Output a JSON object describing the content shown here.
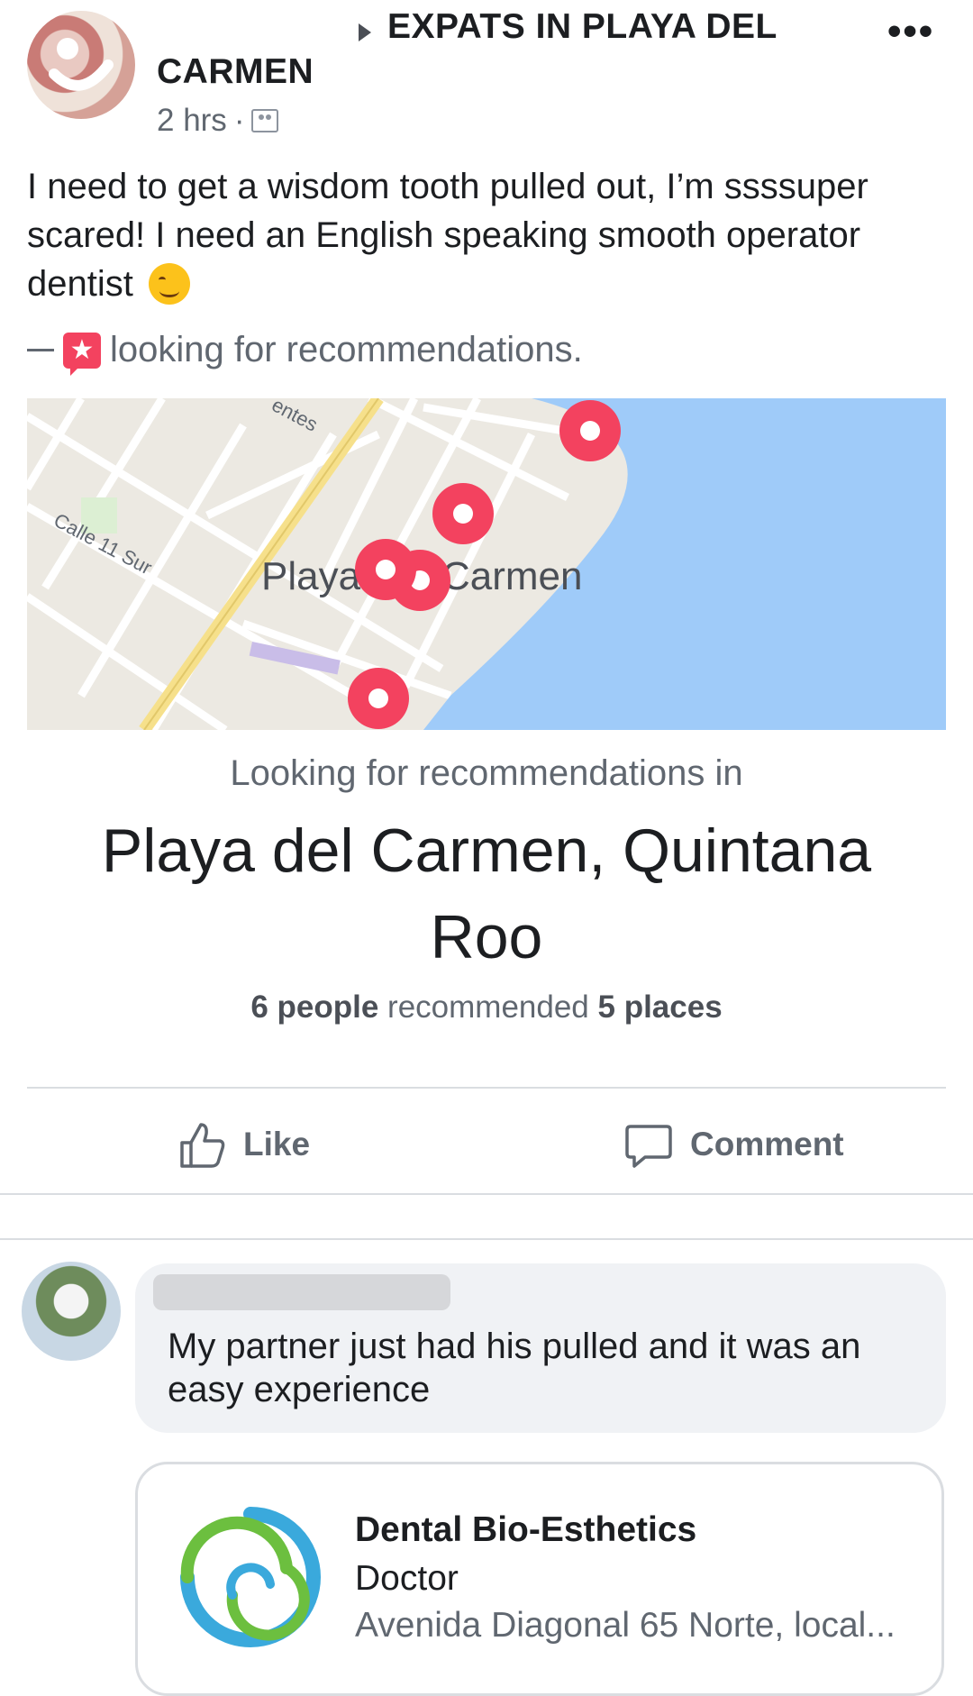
{
  "post": {
    "author": "CARMEN",
    "group_name": "EXPATS IN PLAYA DEL",
    "time": "2 hrs",
    "separator": "·",
    "more_label": "•••",
    "text": "I need to get a wisdom tooth pulled out, I’m ssssuper scared! I need an English speaking smooth operator dentist",
    "activity": "looking for recommendations."
  },
  "map": {
    "labels": {
      "city_left": "Playa",
      "city_right": "Carmen",
      "street": "Calle 11 Sur",
      "top_street": "entes"
    },
    "colors": {
      "water": "#9fcbf9",
      "land": "#ece9e2",
      "pin": "#f3425f",
      "major_road": "#f6e08b"
    }
  },
  "recommendations": {
    "subtitle": "Looking for recommendations in",
    "place": "Playa del Carmen, Quintana Roo",
    "people_count": "6 people",
    "recommended_word": "recommended",
    "places_count": "5 places"
  },
  "actions": {
    "like_label": "Like",
    "comment_label": "Comment"
  },
  "comment": {
    "text": "My partner just had his pulled and it was an easy experience",
    "business": {
      "name": "Dental Bio-Esthetics",
      "category": "Doctor",
      "address": "Avenida Diagonal 65 Norte, local..."
    }
  }
}
